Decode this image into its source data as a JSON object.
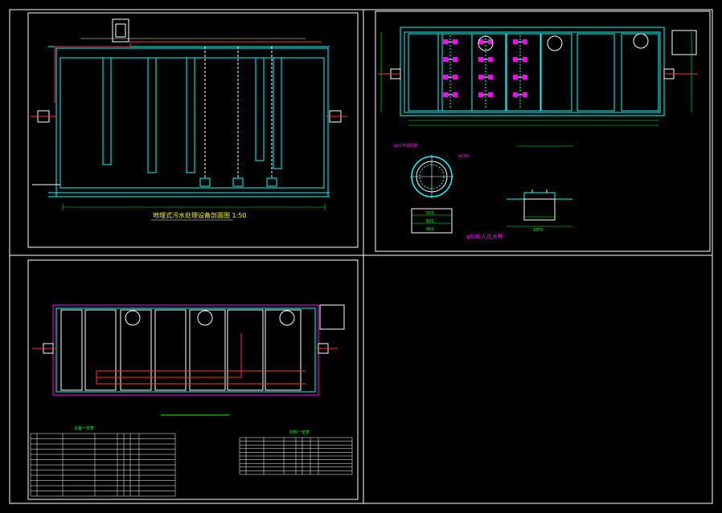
{
  "colors": {
    "background": "#000000",
    "frame": "#ffffff",
    "structure": "#00ffff",
    "dimension": "#00ff00",
    "pipe": "#ff3333",
    "highlight": "#ff00ff",
    "accent": "#ffff00"
  },
  "sheet1": {
    "title": "地埋式污水处理设备剖面图 1:50",
    "title_short": "— 剖面图 1:50"
  },
  "sheet2": {
    "manhole_title": "φ600人孔大样",
    "label_a": "φ10不锈钢筋",
    "label_b": "φ600",
    "dim_500": "500",
    "dim_600": "600",
    "dim_900": "900",
    "dim_1070": "1070"
  },
  "sheet3": {
    "table_left_title": "设备一览表",
    "table_right_title": "材料一览表"
  }
}
